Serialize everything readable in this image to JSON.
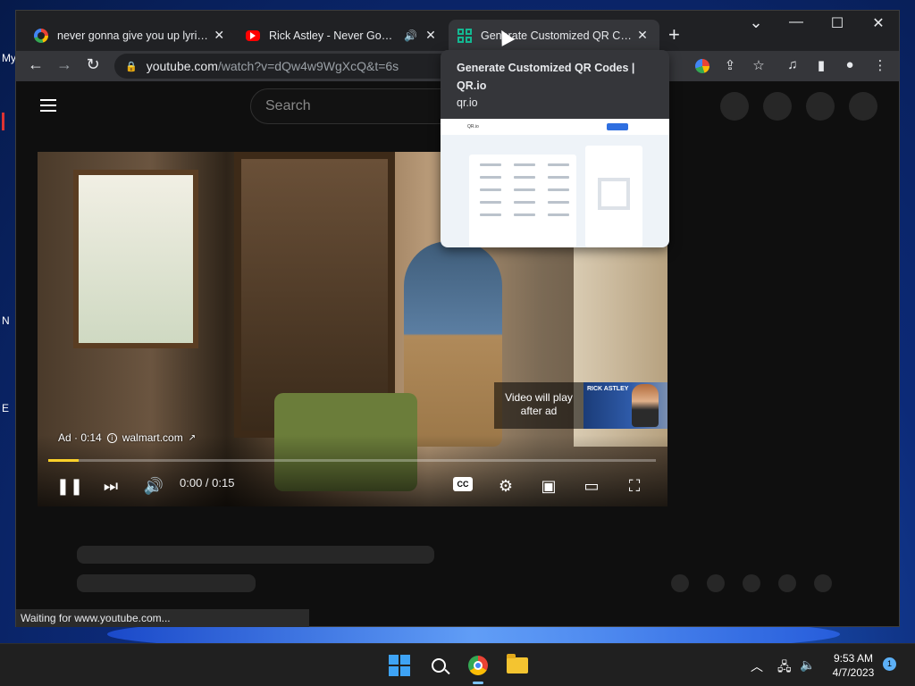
{
  "desktop": {
    "left_labels": [
      "My",
      "N",
      "E"
    ]
  },
  "browser": {
    "tabs": [
      {
        "title": "never gonna give you up lyrics - ",
        "favicon": "google-icon",
        "active": false
      },
      {
        "title": "Rick Astley - Never Gonna G",
        "favicon": "youtube-icon",
        "active": false,
        "audio": true
      },
      {
        "title": "Generate Customized QR Codes",
        "favicon": "qr-icon",
        "active": true
      }
    ],
    "new_tab_label": "+",
    "window_controls": {
      "tab_search": "⌄",
      "minimize": "—",
      "maximize": "☐",
      "close": "✕"
    },
    "toolbar": {
      "back": "←",
      "forward": "→",
      "reload": "↻",
      "url_host": "youtube.com",
      "url_path": "/watch?v=dQw4w9WgXcQ&t=6s"
    },
    "status_text": "Waiting for www.youtube.com..."
  },
  "hover_card": {
    "title": "Generate Customized QR Codes | QR.io",
    "domain": "qr.io",
    "preview_brand": "QR.io"
  },
  "youtube": {
    "search_placeholder": "Search",
    "ad": {
      "label": "Ad · 0:14",
      "advertiser": "walmart.com",
      "video_will_play": "Video will play after ad",
      "thumb_text": "RICK ASTLEY"
    },
    "time": "0:00 / 0:15",
    "progress": 0.05,
    "cc_label": "CC"
  },
  "taskbar": {
    "time": "9:53 AM",
    "date": "4/7/2023",
    "notifications": "1"
  },
  "colors": {
    "progress_fill": "#fcd12a",
    "qr_brand": "#14b892",
    "youtube_red": "#ff0000"
  }
}
